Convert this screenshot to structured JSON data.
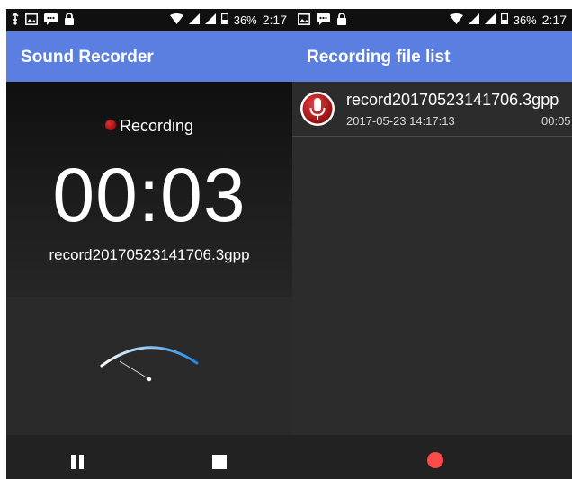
{
  "left": {
    "status_bar": {
      "battery": "36%",
      "time": "2:17"
    },
    "app_title": "Sound Recorder",
    "recording_label": "Recording",
    "timer": "00:03",
    "filename": "record20170523141706.3gpp"
  },
  "right": {
    "status_bar": {
      "battery": "36%",
      "time": "2:17"
    },
    "app_title": "Recording file list",
    "items": [
      {
        "name": "record20170523141706.3gpp",
        "date": "2017-05-23 14:17:13",
        "duration": "00:05"
      }
    ]
  },
  "colors": {
    "app_bar": "#5b7fe0",
    "record_dot": "#ff4a4a",
    "meter_arc_start": "#ffffff",
    "meter_arc_end": "#1e88e5"
  }
}
